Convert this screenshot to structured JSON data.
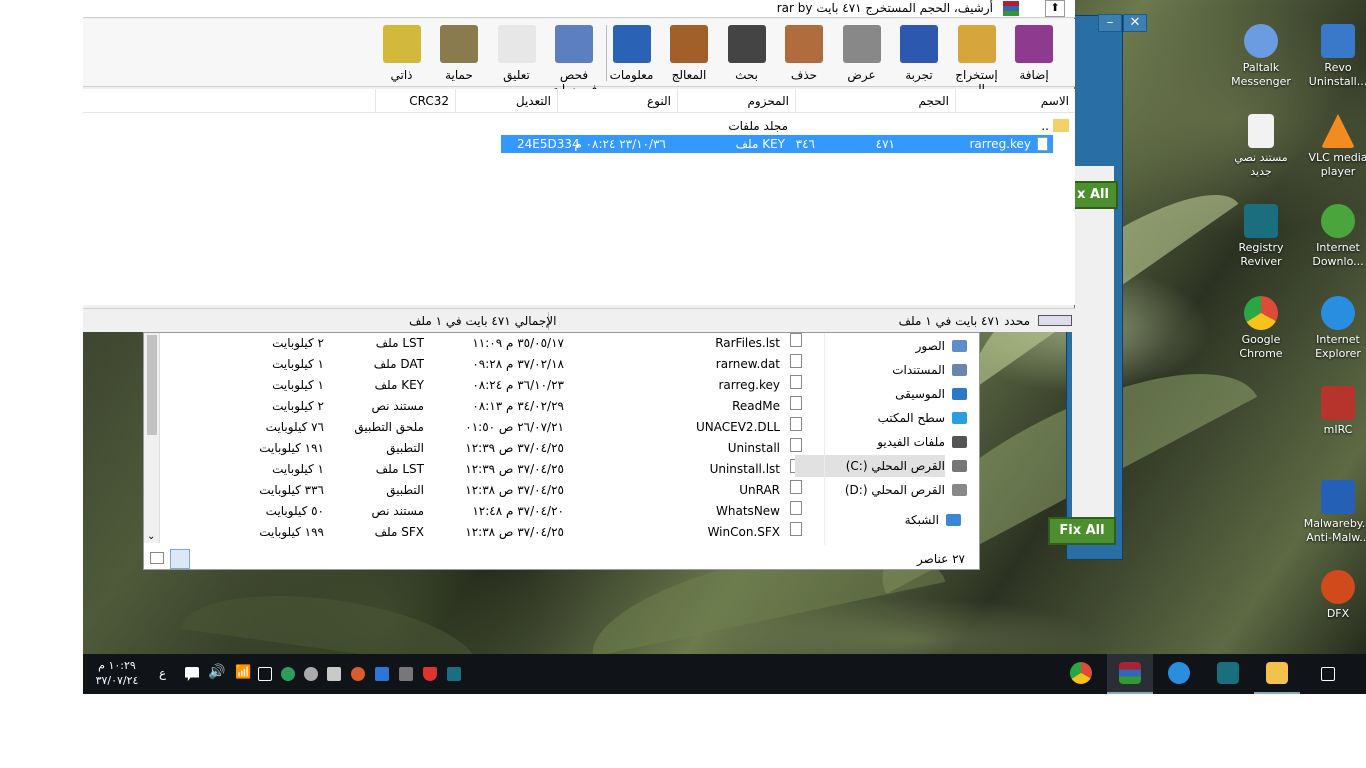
{
  "winrar": {
    "title": "rar by أرشيف، الحجم المستخرج ٤٧١ بايت",
    "toolbar": [
      "إضافة",
      "إستخراج إلى",
      "تجربة",
      "عرض",
      "حذف",
      "بحث",
      "المعالج",
      "معلومات",
      "فحص فيروسات",
      "تعليق",
      "حماية",
      "ذاتي"
    ],
    "columns": [
      "الاسم",
      "الحجم",
      "المحزوم",
      "النوع",
      "التعديل",
      "CRC32"
    ],
    "parent_row": {
      "name": "..",
      "type": "مجلد ملفات"
    },
    "selected_row": {
      "name": "rarreg.key",
      "size": "٤٧١",
      "packed": "٣٤٦",
      "type": "ملف KEY",
      "modified": "٢٣/١٠/٣٦ ٠٨:٢٤ م",
      "crc": "24E5D334"
    },
    "status_right": "محدد ٤٧١ بايت في ١ ملف",
    "status_left": "الإجمالي ٤٧١ بايت في ١ ملف"
  },
  "explorer": {
    "rows": [
      {
        "name": "RarFiles.lst",
        "date": "٣٥/٠٥/١٧ م ١١:٠٩",
        "type": "ملف LST",
        "size": "٢ كيلوبايت"
      },
      {
        "name": "rarnew.dat",
        "date": "٣٧/٠٢/١٨ م ٠٩:٢٨",
        "type": "ملف DAT",
        "size": "١ كيلوبايت"
      },
      {
        "name": "rarreg.key",
        "date": "٣٦/١٠/٢٣ م ٠٨:٢٤",
        "type": "ملف KEY",
        "size": "١ كيلوبايت"
      },
      {
        "name": "ReadMe",
        "date": "٣٤/٠٢/٢٩ م ٠٨:١٣",
        "type": "مستند نص",
        "size": "٢ كيلوبايت"
      },
      {
        "name": "UNACEV2.DLL",
        "date": "٢٦/٠٧/٢١ ص ٠١:٥٠",
        "type": "ملحق التطبيق",
        "size": "٧٦ كيلوبايت"
      },
      {
        "name": "Uninstall",
        "date": "٣٧/٠٤/٢٥ ص ١٢:٣٩",
        "type": "التطبيق",
        "size": "١٩١ كيلوبايت"
      },
      {
        "name": "Uninstall.lst",
        "date": "٣٧/٠٤/٢٥ ص ١٢:٣٩",
        "type": "ملف LST",
        "size": "١ كيلوبايت"
      },
      {
        "name": "UnRAR",
        "date": "٣٧/٠٤/٢٥ ص ١٢:٣٨",
        "type": "التطبيق",
        "size": "٣٣٦ كيلوبايت"
      },
      {
        "name": "WhatsNew",
        "date": "٣٧/٠٤/٢٠ م ١٢:٤٨",
        "type": "مستند نص",
        "size": "٥٠ كيلوبايت"
      },
      {
        "name": "WinCon.SFX",
        "date": "٣٧/٠٤/٢٥ ص ١٢:٣٨",
        "type": "ملف SFX",
        "size": "١٩٩ كيلوبايت"
      }
    ],
    "nav": [
      "الصور",
      "المستندات",
      "الموسيقى",
      "سطح المكتب",
      "ملفات الفيديو",
      "القرص المحلي (:C)",
      "القرص المحلي (:D)",
      "الشبكة"
    ],
    "item_count": "٢٧ عناصر"
  },
  "desktop_icons": [
    {
      "label": "Revo Uninstall...",
      "color": "#3a78c9"
    },
    {
      "label": "Paltalk Messenger",
      "color": "#6b9be0"
    },
    {
      "label": "VLC media player",
      "color": "#f28c1f"
    },
    {
      "label": "مستند نصي جديد",
      "color": "#f2f2f2"
    },
    {
      "label": "Internet Downlo...",
      "color": "#4aa53c"
    },
    {
      "label": "Registry Reviver",
      "color": "#1b6e7e"
    },
    {
      "label": "Internet Explorer",
      "color": "#2a8ee0"
    },
    {
      "label": "Google Chrome",
      "color": "#dd4b39"
    },
    {
      "label": "mIRC",
      "color": "#b7342c"
    },
    {
      "label": "Malwareby... Anti-Malw...",
      "color": "#2460b5"
    },
    {
      "label": "DFX",
      "color": "#d04a1c"
    }
  ],
  "bg_window": {
    "fix_label": "Fix All",
    "fix_label_partial": "x All"
  },
  "taskbar": {
    "time": "١٠:٢٩ م",
    "date": "٣٧/٠٧/٢٤",
    "lang": "ع"
  }
}
